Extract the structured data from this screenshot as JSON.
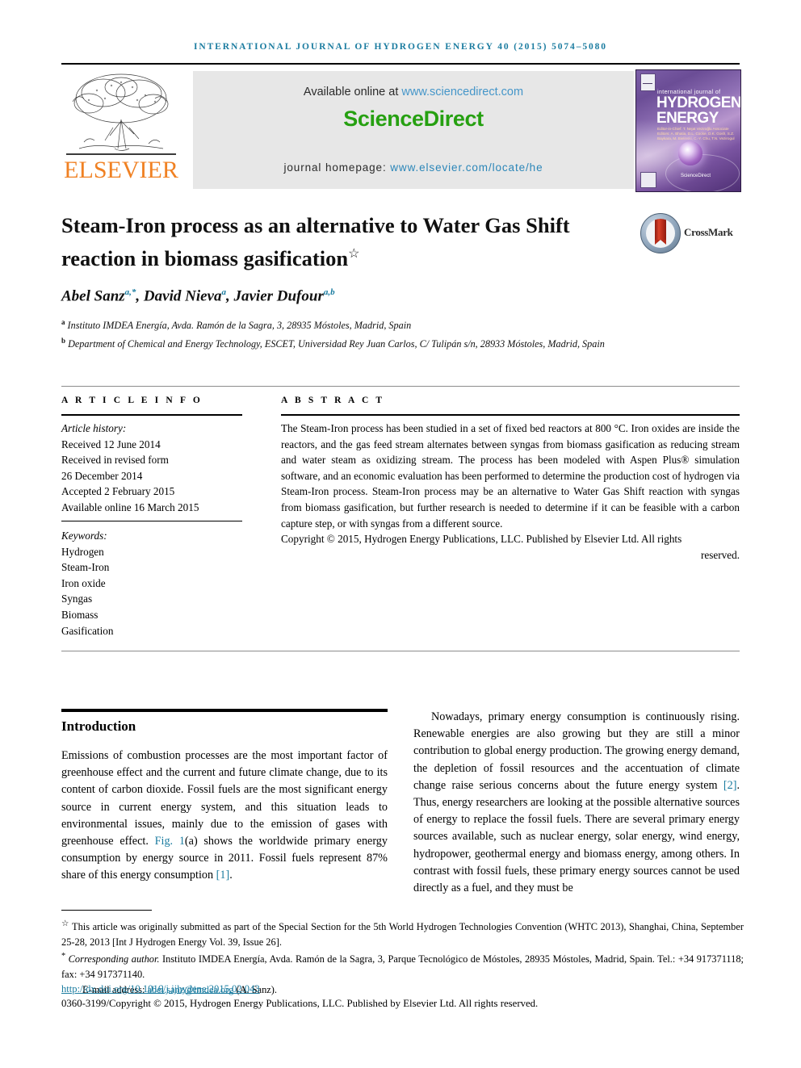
{
  "running_head": "INTERNATIONAL JOURNAL OF HYDROGEN ENERGY 40 (2015) 5074–5080",
  "masthead": {
    "publisher_name": "ELSEVIER",
    "available_prefix": "Available online at ",
    "sciencedirect_url": "www.sciencedirect.com",
    "sciencedirect_logo": "ScienceDirect",
    "homepage_label": "journal homepage: ",
    "homepage_url": "www.elsevier.com/locate/he",
    "cover": {
      "line_small": "international journal of",
      "line1": "HYDROGEN",
      "line2": "ENERGY",
      "editors": "Editor-in-Chief: T. Nejat Veziroğlu\nAssociate Editors: A. Bhatia, D.L. Cocke, D.K. Gosh, S.Z. Baykara, M. Bielinski, C.-Y. Chu, T.N. Vezirogul",
      "bottom_brand": "ScienceDirect"
    }
  },
  "accent_colors": {
    "journal_blue": "#1b7ca0",
    "link_blue": "#2b86b8",
    "elsevier_orange": "#F08123",
    "sciencedirect_green": "#26a011",
    "crossmark_red": "#b52a18"
  },
  "article": {
    "title": "Steam-Iron process as an alternative to Water Gas Shift reaction in biomass gasification",
    "title_footnote_marker": "☆",
    "crossmark_label": "CrossMark",
    "authors": [
      {
        "name": "Abel Sanz",
        "marks": "a,*"
      },
      {
        "name": "David Nieva",
        "marks": "a"
      },
      {
        "name": "Javier Dufour",
        "marks": "a,b"
      }
    ],
    "affiliations": [
      {
        "mark": "a",
        "text": "Instituto IMDEA Energía, Avda. Ramón de la Sagra, 3, 28935 Móstoles, Madrid, Spain"
      },
      {
        "mark": "b",
        "text": "Department of Chemical and Energy Technology, ESCET, Universidad Rey Juan Carlos, C/ Tulipán s/n, 28933 Móstoles, Madrid, Spain"
      }
    ]
  },
  "info": {
    "heading": "A R T I C L E   I N F O",
    "history_label": "Article history:",
    "history": [
      "Received 12 June 2014",
      "Received in revised form",
      "26 December 2014",
      "Accepted 2 February 2015",
      "Available online 16 March 2015"
    ],
    "keywords_label": "Keywords:",
    "keywords": [
      "Hydrogen",
      "Steam-Iron",
      "Iron oxide",
      "Syngas",
      "Biomass",
      "Gasification"
    ]
  },
  "abstract": {
    "heading": "A B S T R A C T",
    "text": "The Steam-Iron process has been studied in a set of fixed bed reactors at 800 °C. Iron oxides are inside the reactors, and the gas feed stream alternates between syngas from biomass gasification as reducing stream and water steam as oxidizing stream. The process has been modeled with Aspen Plus® simulation software, and an economic evaluation has been performed to determine the production cost of hydrogen via Steam-Iron process. Steam-Iron process may be an alternative to Water Gas Shift reaction with syngas from biomass gasification, but further research is needed to determine if it can be feasible with a carbon capture step, or with syngas from a different source.",
    "copyright_main": "Copyright © 2015, Hydrogen Energy Publications, LLC. Published by Elsevier Ltd. All rights",
    "copyright_last": "reserved."
  },
  "body": {
    "section_title": "Introduction",
    "left_paragraph_part1": "Emissions of combustion processes are the most important factor of greenhouse effect and the current and future climate change, due to its content of carbon dioxide. Fossil fuels are the most significant energy source in current energy system, and this situation leads to environmental issues, mainly due to the emission of gases with greenhouse effect. ",
    "left_fig_link": "Fig. 1",
    "left_paragraph_part2": "(a) shows the worldwide primary energy consumption by energy source in 2011. Fossil fuels represent 87% share of this energy consumption ",
    "left_ref_link": "[1]",
    "left_paragraph_part3": ".",
    "right_paragraph_part1": "Nowadays, primary energy consumption is continuously rising. Renewable energies are also growing but they are still a minor contribution to global energy production. The growing energy demand, the depletion of fossil resources and the accentuation of climate change raise serious concerns about the future energy system ",
    "right_ref_link": "[2]",
    "right_paragraph_part2": ". Thus, energy researchers are looking at the possible alternative sources of energy to replace the fossil fuels. There are several primary energy sources available, such as nuclear energy, solar energy, wind energy, hydropower, geothermal energy and biomass energy, among others. In contrast with fossil fuels, these primary energy sources cannot be used directly as a fuel, and they must be"
  },
  "footnotes": {
    "star_marker": "☆",
    "star_text": " This article was originally submitted as part of the Special Section for the 5th World Hydrogen Technologies Convention (WHTC 2013), Shanghai, China, September 25-28, 2013 [Int J Hydrogen Energy Vol. 39, Issue 26].",
    "corresponding_marker": "*",
    "corresponding_label": " Corresponding author.",
    "corresponding_text": " Instituto IMDEA Energía, Avda. Ramón de la Sagra, 3, Parque Tecnológico de Móstoles, 28935 Móstoles, Madrid, Spain. Tel.: +34 917371118; fax: +34 917371140.",
    "email_label": "E-mail address: ",
    "email": "abel.sanz@imdea.org",
    "email_suffix": " (A. Sanz).",
    "doi": "http://dx.doi.org/10.1016/j.ijhydene.2015.02.043",
    "issn_copyright": "0360-3199/Copyright © 2015, Hydrogen Energy Publications, LLC. Published by Elsevier Ltd. All rights reserved."
  }
}
